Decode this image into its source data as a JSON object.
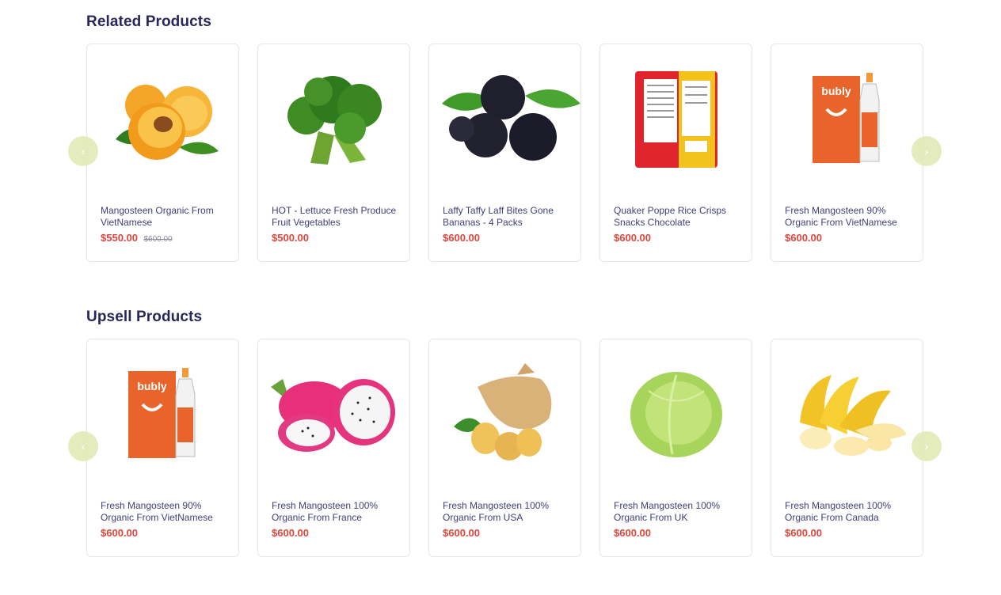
{
  "related": {
    "title": "Related Products",
    "products": [
      {
        "name": "Mangosteen Organic From VietNamese",
        "price": "$550.00",
        "old_price": "$600.00",
        "image": "apricot-image"
      },
      {
        "name": "HOT - Lettuce Fresh Produce Fruit Vegetables",
        "price": "$500.00",
        "image": "broccoli-image"
      },
      {
        "name": "Laffy Taffy Laff Bites Gone Bananas - 4 Packs",
        "price": "$600.00",
        "image": "acai-berries-image"
      },
      {
        "name": "Quaker Poppe Rice Crisps Snacks Chocolate",
        "price": "$600.00",
        "image": "snack-bag-image"
      },
      {
        "name": "Fresh Mangosteen 90% Organic From VietNamese",
        "price": "$600.00",
        "image": "bubly-drops-image"
      }
    ]
  },
  "upsell": {
    "title": "Upsell Products",
    "products": [
      {
        "name": "Fresh Mangosteen 90% Organic From VietNamese",
        "price": "$600.00",
        "image": "bubly-drops-image"
      },
      {
        "name": "Fresh Mangosteen 100% Organic From France",
        "price": "$600.00",
        "image": "dragon-fruit-image"
      },
      {
        "name": "Fresh Mangosteen 100% Organic From USA",
        "price": "$600.00",
        "image": "ginger-image"
      },
      {
        "name": "Fresh Mangosteen 100% Organic From UK",
        "price": "$600.00",
        "image": "cabbage-image"
      },
      {
        "name": "Fresh Mangosteen 100% Organic From Canada",
        "price": "$600.00",
        "image": "banana-image"
      }
    ]
  },
  "nav": {
    "prev_icon": "‹",
    "next_icon": "›"
  },
  "colors": {
    "heading": "#27275b",
    "price": "#e0463c",
    "nav_button": "#e2ebb9",
    "card_border": "#e6e6ec"
  }
}
